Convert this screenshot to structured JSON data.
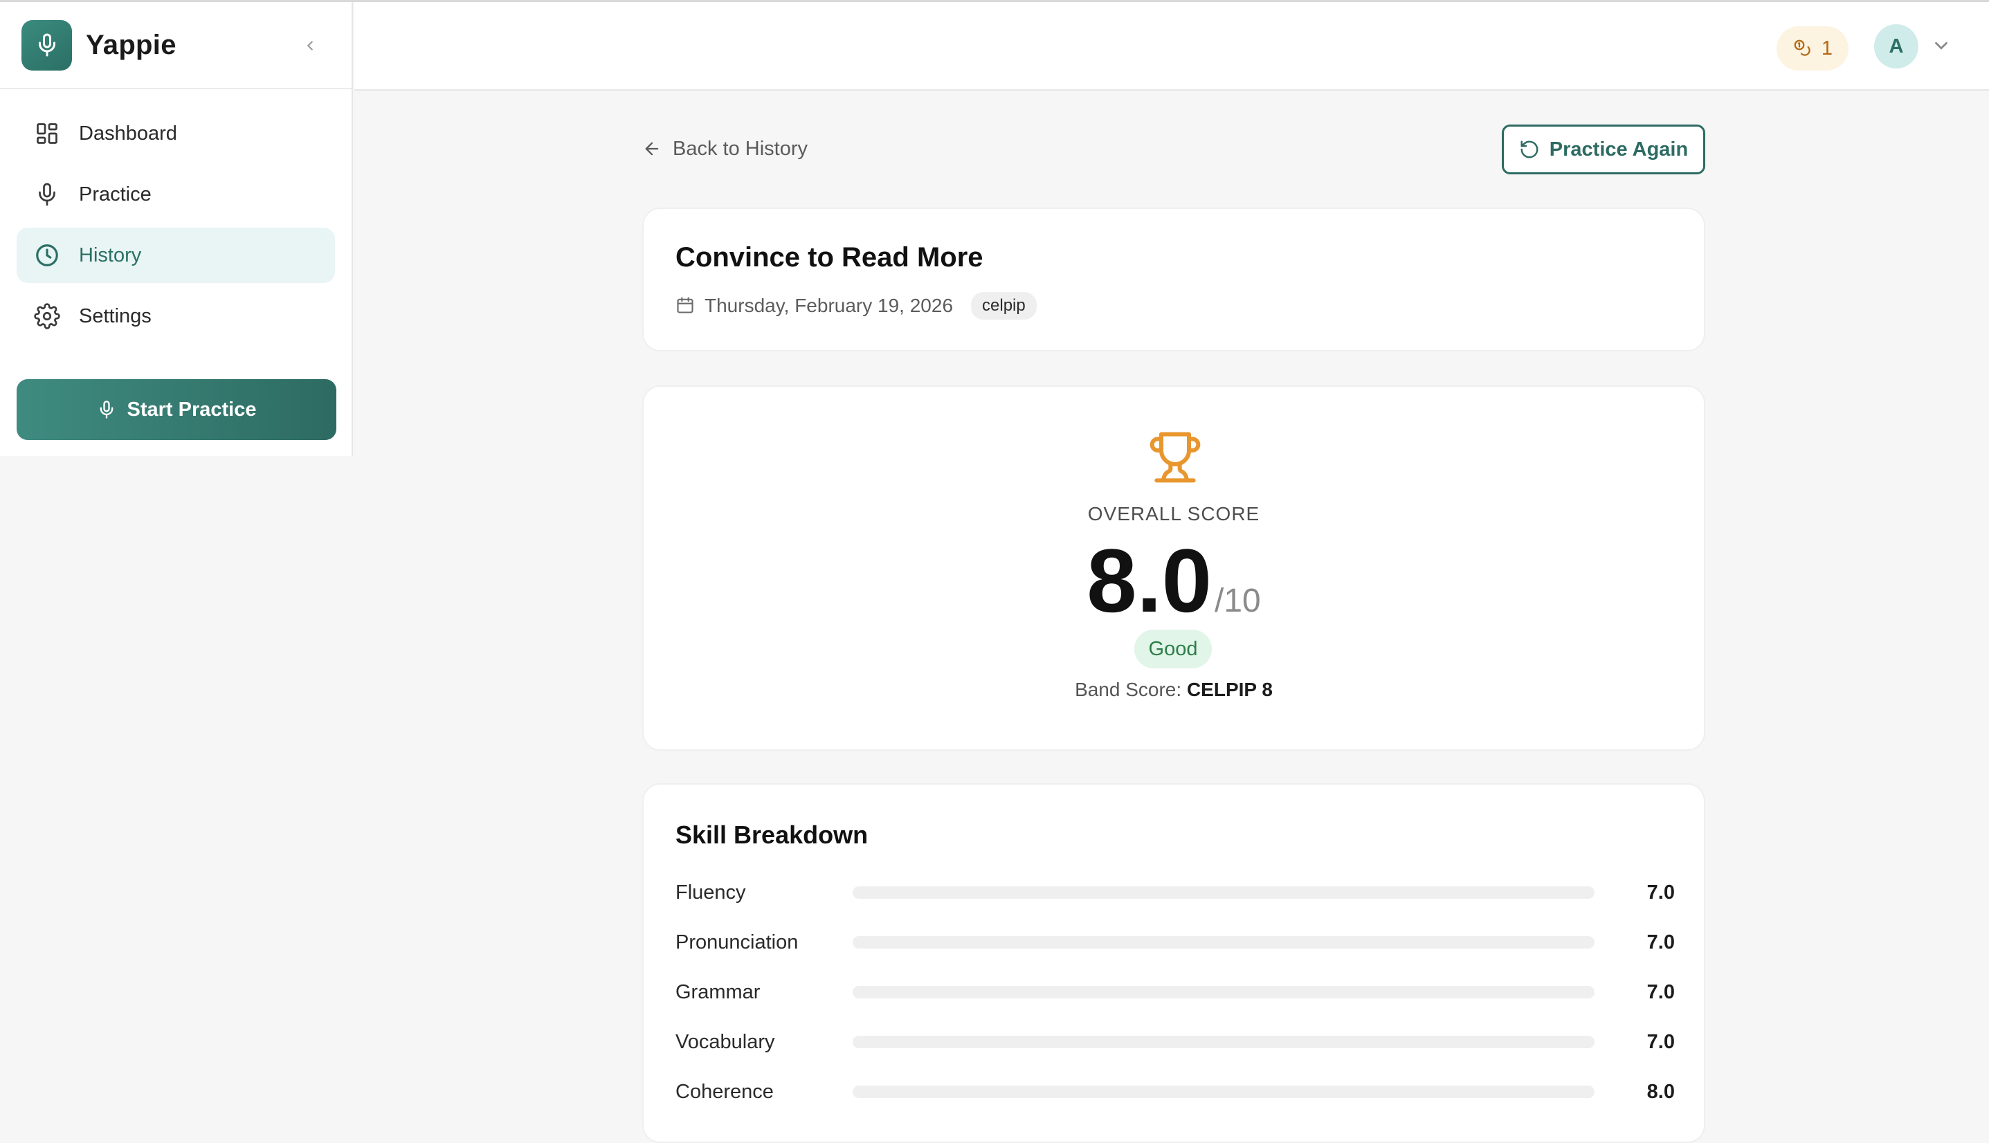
{
  "app": {
    "name": "Yappie"
  },
  "sidebar": {
    "items": [
      {
        "label": "Dashboard",
        "icon": "grid-icon",
        "active": false
      },
      {
        "label": "Practice",
        "icon": "mic-icon",
        "active": false
      },
      {
        "label": "History",
        "icon": "clock-icon",
        "active": true
      },
      {
        "label": "Settings",
        "icon": "gear-icon",
        "active": false
      }
    ],
    "start_label": "Start Practice"
  },
  "header": {
    "credits": "1",
    "avatar_initial": "A"
  },
  "nav": {
    "back_label": "Back to History",
    "practice_again_label": "Practice Again"
  },
  "session": {
    "title": "Convince to Read More",
    "date": "Thursday, February 19, 2026",
    "tag": "celpip"
  },
  "score": {
    "label": "OVERALL SCORE",
    "value": "8.0",
    "max": "/10",
    "rating": "Good",
    "band_label": "Band Score:",
    "band_value": "CELPIP 8"
  },
  "skills": {
    "title": "Skill Breakdown",
    "items": [
      {
        "name": "Fluency",
        "value": "7.0",
        "score": 7.0
      },
      {
        "name": "Pronunciation",
        "value": "7.0",
        "score": 7.0
      },
      {
        "name": "Grammar",
        "value": "7.0",
        "score": 7.0
      },
      {
        "name": "Vocabulary",
        "value": "7.0",
        "score": 7.0
      },
      {
        "name": "Coherence",
        "value": "8.0",
        "score": 8.0
      }
    ],
    "max": 10
  },
  "colors": {
    "accent": "#2d6b62",
    "bar": "#5ab584",
    "trophy": "#e8962e",
    "credits_bg": "#fdf3e1"
  }
}
